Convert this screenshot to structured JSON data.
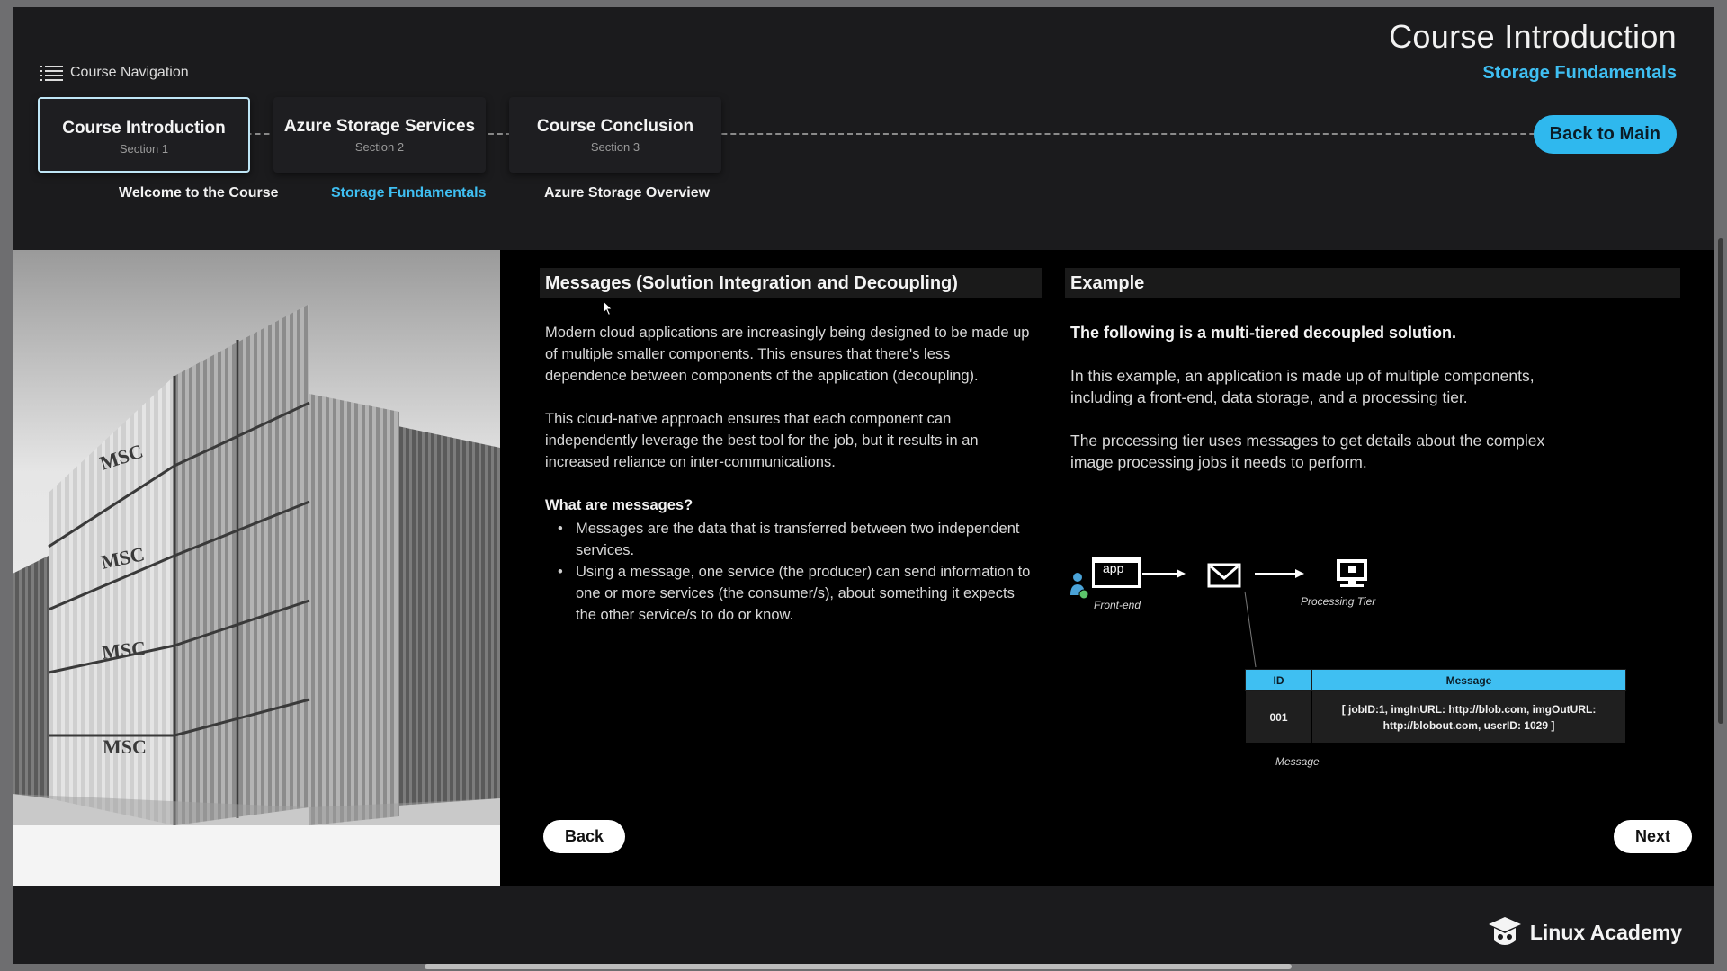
{
  "header": {
    "nav_toggle_label": "Course Navigation",
    "title": "Course Introduction",
    "subtitle": "Storage Fundamentals",
    "back_to_main_label": "Back to Main"
  },
  "sections": [
    {
      "title": "Course Introduction",
      "sub": "Section 1",
      "active": true
    },
    {
      "title": "Azure Storage Services",
      "sub": "Section 2",
      "active": false
    },
    {
      "title": "Course Conclusion",
      "sub": "Section 3",
      "active": false
    }
  ],
  "section_links": [
    {
      "label": "Welcome to the Course",
      "current": false
    },
    {
      "label": "Storage Fundamentals",
      "current": true
    },
    {
      "label": "Azure Storage Overview",
      "current": false
    }
  ],
  "left": {
    "heading": "Messages (Solution Integration and Decoupling)",
    "p1": "Modern cloud applications are increasingly being designed to be made up of multiple smaller components. This ensures that there's less dependence between components of the application (decoupling).",
    "p2": "This cloud-native approach ensures that each component can independently leverage the best tool for the job, but it results in an increased reliance on inter-communications.",
    "question": "What are messages?",
    "bullets": [
      "Messages are the data that is transferred between two independent services.",
      "Using a message, one service (the producer) can send information to one or more services (the consumer/s), about something it expects the other service/s to do or know."
    ]
  },
  "right": {
    "heading": "Example",
    "lead": "The following is a multi-tiered decoupled solution.",
    "p1": "In this example, an application is made up of multiple components, including a front-end, data storage, and a processing tier.",
    "p2": "The processing tier uses messages to get details about the complex image processing jobs it needs to perform."
  },
  "diagram": {
    "app_label": "app",
    "frontend_label": "Front-end",
    "processing_label": "Processing Tier",
    "message_label": "Message",
    "table_headers": [
      "ID",
      "Message"
    ],
    "table_row": [
      "001",
      "[ jobID:1, imgInURL: http://blob.com, imgOutURL: http://blobout.com, userID: 1029 ]"
    ]
  },
  "buttons": {
    "back": "Back",
    "next": "Next"
  },
  "footer": {
    "brand": "Linux Academy"
  },
  "colors": {
    "accent": "#3fbff2",
    "background": "#1b1b1d",
    "content_bg": "#000000"
  },
  "icons": [
    "menu-icon",
    "cursor-icon",
    "user-icon",
    "mail-icon",
    "server-icon",
    "linux-academy-logo"
  ]
}
